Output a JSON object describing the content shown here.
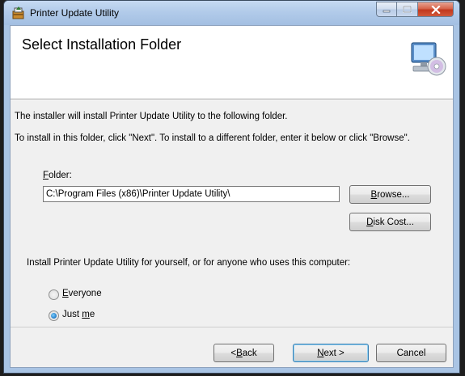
{
  "window": {
    "title": "Printer Update Utility",
    "title_icon": "installer-icon"
  },
  "banner": {
    "title": "Select Installation Folder",
    "icon": "computer-cd-icon"
  },
  "body": {
    "line1": "The installer will install Printer Update Utility to the following folder.",
    "line2": "To install in this folder, click \"Next\". To install to a different folder, enter it below or click \"Browse\".",
    "folder_label_accel": "F",
    "folder_label_rest": "older:",
    "folder_value": "C:\\Program Files (x86)\\Printer Update Utility\\",
    "browse_accel": "B",
    "browse_rest": "rowse...",
    "disk_cost_accel": "D",
    "disk_cost_rest": "isk Cost...",
    "install_for": "Install Printer Update Utility for yourself, or for anyone who uses this computer:",
    "everyone_accel": "E",
    "everyone_rest": "veryone",
    "justme_pre": "Just ",
    "justme_accel": "m",
    "justme_post": "e",
    "selected_option": "Just me"
  },
  "footer": {
    "back_pre": "< ",
    "back_accel": "B",
    "back_rest": "ack",
    "next_accel": "N",
    "next_rest": "ext >",
    "cancel": "Cancel"
  },
  "colors": {
    "accent": "#3c7fb1",
    "close_button": "#c2381d",
    "title_bar": "#b2cbea"
  }
}
